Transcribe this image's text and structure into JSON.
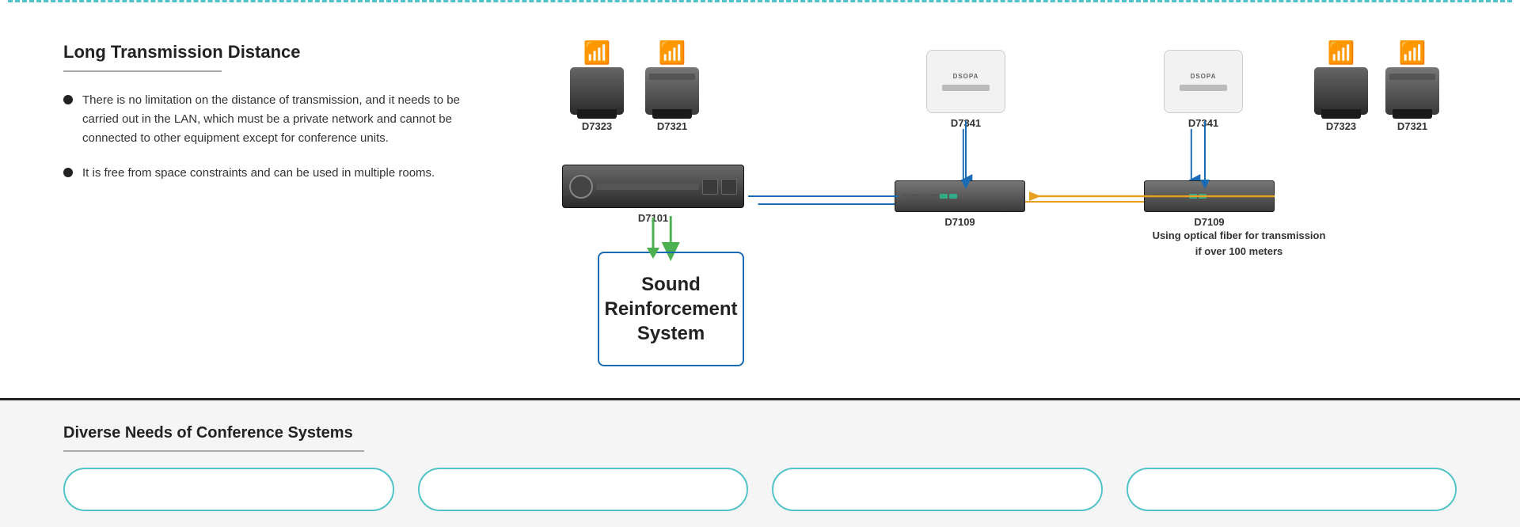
{
  "top_border": "dashed",
  "left_panel": {
    "title": "Long Transmission Distance",
    "bullet1": "There is no limitation on the distance of transmission, and it needs to be carried out in the LAN, which must be a private network and cannot be connected to other equipment except for conference units.",
    "bullet2": "It is free from space constraints and can be used in multiple rooms."
  },
  "diagram": {
    "group1": {
      "d7323_label": "D7323",
      "d7321_label": "D7321",
      "d7101_label": "D7101",
      "d7109_label_1": "D7109",
      "d7341_label_1": "D7341"
    },
    "group2": {
      "d7109_label_2": "D7109",
      "d7341_label_2": "D7341",
      "d7323_label_2": "D7323",
      "d7321_label_2": "D7321"
    },
    "sound_box": "Sound\nReinforcement\nSystem",
    "sound_box_line1": "Sound",
    "sound_box_line2": "Reinforcement",
    "sound_box_line3": "System",
    "optical_fiber_text": "Using optical fiber for transmission\nif over 100 meters",
    "optical_line1": "Using optical fiber for transmission",
    "optical_line2": "if over 100 meters"
  },
  "bottom_section": {
    "title": "Diverse Needs of Conference Systems",
    "cards": [
      {
        "label": ""
      },
      {
        "label": ""
      },
      {
        "label": ""
      },
      {
        "label": ""
      }
    ]
  },
  "colors": {
    "blue": "#1a6bb5",
    "teal": "#4fc3c8",
    "orange": "#e8a020",
    "green": "#4caf50",
    "dark": "#222222"
  }
}
